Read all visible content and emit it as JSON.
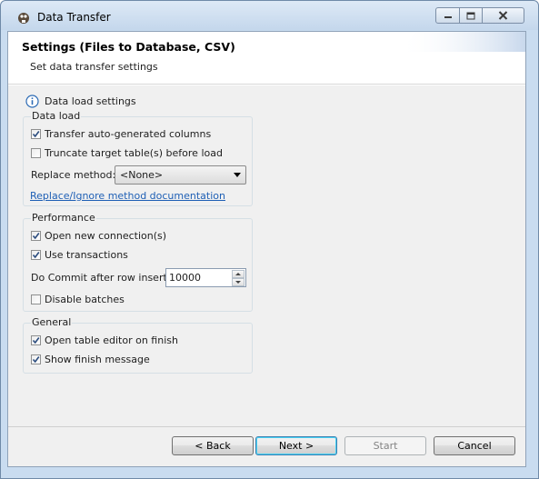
{
  "window": {
    "title": "Data Transfer",
    "icon": "dbeaver-beaver-icon",
    "controls": [
      "minimize-icon",
      "maximize-icon",
      "close-icon"
    ]
  },
  "header": {
    "title": "Settings (Files to Database, CSV)",
    "subtitle": "Set data transfer settings"
  },
  "section_label": "Data load settings",
  "groups": {
    "data_load": {
      "title": "Data load",
      "transfer_auto_columns": {
        "label": "Transfer auto-generated columns",
        "checked": true
      },
      "truncate_tables": {
        "label": "Truncate target table(s) before load",
        "checked": false
      },
      "replace_method": {
        "label": "Replace method:",
        "value": "<None>"
      },
      "doc_link": "Replace/Ignore method documentation"
    },
    "performance": {
      "title": "Performance",
      "open_new_connections": {
        "label": "Open new connection(s)",
        "checked": true
      },
      "use_transactions": {
        "label": "Use transactions",
        "checked": true
      },
      "commit_after": {
        "label": "Do Commit after row insert:",
        "value": "10000"
      },
      "disable_batches": {
        "label": "Disable batches",
        "checked": false
      }
    },
    "general": {
      "title": "General",
      "open_table_editor": {
        "label": "Open table editor on finish",
        "checked": true
      },
      "show_finish_message": {
        "label": "Show finish message",
        "checked": true
      }
    }
  },
  "buttons": {
    "back": "< Back",
    "next": "Next >",
    "start": "Start",
    "cancel": "Cancel"
  },
  "colors": {
    "link": "#1e5fb5",
    "frame": "#c9dcf0",
    "panel": "#f0f0f0"
  }
}
